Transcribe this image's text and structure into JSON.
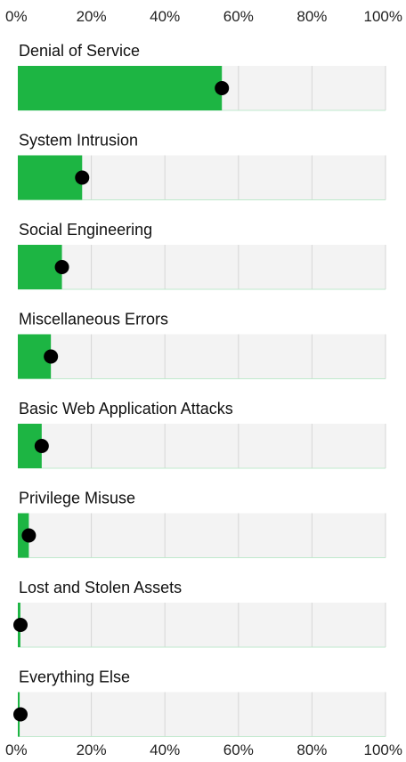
{
  "chart_data": {
    "type": "bar",
    "orientation": "horizontal",
    "categories": [
      "Denial of Service",
      "System Intrusion",
      "Social Engineering",
      "Miscellaneous Errors",
      "Basic Web Application Attacks",
      "Privilege Misuse",
      "Lost and Stolen Assets",
      "Everything Else"
    ],
    "values": [
      55.5,
      17.5,
      12,
      9,
      6.5,
      3,
      0.7,
      0.5
    ],
    "dots": [
      55.5,
      17.5,
      12,
      9,
      6.5,
      3,
      0.7,
      0.5
    ],
    "xlim": [
      0,
      100
    ],
    "ticks": [
      "0%",
      "20%",
      "40%",
      "60%",
      "80%",
      "100%"
    ],
    "tick_values": [
      0,
      20,
      40,
      60,
      80,
      100
    ],
    "axis_labels_top": true,
    "axis_labels_bottom": true,
    "grid": true,
    "colors": {
      "bar": "#1db543",
      "track": "#f3f3f3",
      "grid": "#d6d6d6",
      "dot": "#000000",
      "baseline": "#bfe9cc"
    }
  }
}
